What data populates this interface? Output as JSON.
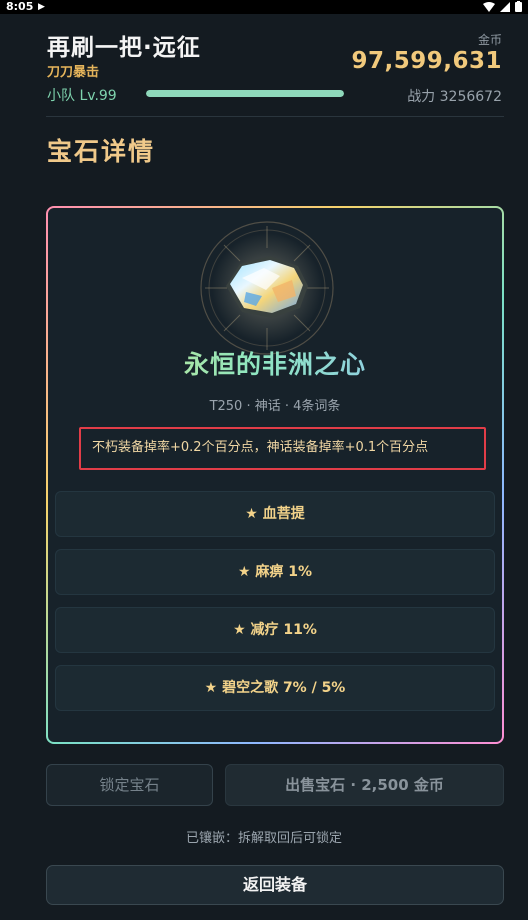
{
  "status_bar": {
    "time": "8:05"
  },
  "header": {
    "title": "再刷一把·远征",
    "subtitle": "刀刀暴击",
    "coin_label": "金币",
    "coin_value": "97,599,631",
    "squad_level": "小队 Lv.99",
    "xp_progress": 1.0,
    "power": "战力 3256672"
  },
  "page_title": "宝石详情",
  "gem": {
    "name": "永恒的非洲之心",
    "meta": "T250 · 神话 · 4条词条",
    "effect": "不朽装备掉率+0.2个百分点，神话装备掉率+0.1个百分点",
    "affixes": [
      {
        "label": "★ 血菩提"
      },
      {
        "label": "★ 麻痹 1%"
      },
      {
        "label": "★ 减疗 11%"
      },
      {
        "label": "★ 碧空之歌 7% / 5%"
      }
    ]
  },
  "actions": {
    "lock_label": "锁定宝石",
    "sell_label": "出售宝石 · 2,500 金币",
    "inlay_note": "已镶嵌：拆解取回后可锁定",
    "back_label": "返回装备"
  },
  "colors": {
    "background": "#141b21",
    "gold": "#f1c97c",
    "accent_green": "#8fd9bb",
    "highlight_border": "#e23d48"
  },
  "icons": [
    "play-icon",
    "wifi-icon",
    "signal-icon",
    "battery-icon",
    "gem-icon"
  ]
}
